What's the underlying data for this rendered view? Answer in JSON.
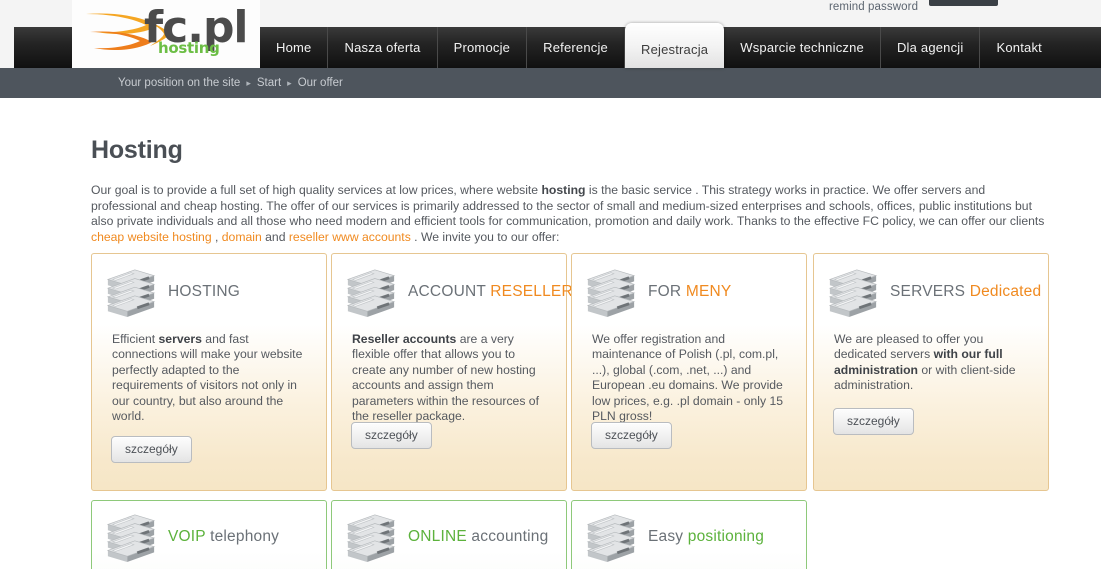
{
  "top": {
    "remind_password": "remind password"
  },
  "logo": {
    "word": "fc.pl",
    "sub": "hosting",
    "swoosh_icon": "swoosh-icon"
  },
  "nav": {
    "items": [
      {
        "label": "Home",
        "active": false
      },
      {
        "label": "Nasza oferta",
        "active": false
      },
      {
        "label": "Promocje",
        "active": false
      },
      {
        "label": "Referencje",
        "active": false
      },
      {
        "label": "Rejestracja",
        "active": true
      },
      {
        "label": "Wsparcie techniczne",
        "active": false
      },
      {
        "label": "Dla agencji",
        "active": false
      },
      {
        "label": "Kontakt",
        "active": false
      }
    ]
  },
  "breadcrumb": {
    "label": "Your position on the site",
    "sep": "▸",
    "items": [
      "Start",
      "Our offer"
    ]
  },
  "main": {
    "title": "Hosting",
    "intro_prefix": "Our goal is to provide a full set of high quality services at low prices, where website ",
    "intro_b1": "hosting",
    "intro_mid": " is the basic service . This strategy works in practice. We offer servers and professional and cheap hosting. The offer of our services is primarily addressed to the sector of small and medium-sized enterprises and schools, offices, public institutions but also private individuals and all those who need modern and efficient tools for communication, promotion and daily work. Thanks to the effective FC policy, we can offer our clients ",
    "link1": "cheap website hosting",
    "comma": " , ",
    "link2": "domain",
    "and": " and ",
    "link3": "reseller www accounts",
    "intro_suffix": " . We invite you to our offer:"
  },
  "cards": [
    {
      "icon": "server-stack-icon",
      "title_part1": "HOSTING",
      "title_part1_color": "gray",
      "title_part2": "",
      "title_part2_color": "gray",
      "body_pre": "Efficient ",
      "body_b": "servers",
      "body_post": " and fast connections will make your website perfectly adapted to the requirements of visitors not only in our country, but also around the world.",
      "button": "szczegóły"
    },
    {
      "icon": "server-stack-icon",
      "title_part1": "ACCOUNT ",
      "title_part1_color": "gray",
      "title_part2": "RESELLER",
      "title_part2_color": "orange",
      "body_pre": "",
      "body_b": "Reseller accounts",
      "body_post": " are a very flexible offer that allows you to create any number of new hosting accounts and assign them parameters within the resources of the reseller package.",
      "button": "szczegóły"
    },
    {
      "icon": "server-stack-icon",
      "title_part1": "FOR ",
      "title_part1_color": "gray",
      "title_part2": "MENY",
      "title_part2_color": "orange",
      "body_pre": "We offer registration and maintenance of Polish (.pl, com.pl, ...), global (.com, .net, ...) and European .eu domains. We provide low prices, e.g. .pl domain - only 15 PLN gross!",
      "body_b": "",
      "body_post": "",
      "button": "szczegóły"
    },
    {
      "icon": "server-stack-icon",
      "title_part1": "SERVERS ",
      "title_part1_color": "gray",
      "title_part2": "Dedicated",
      "title_part2_color": "orange",
      "body_pre": "We are pleased to offer you dedicated servers ",
      "body_b": "with our full administration",
      "body_post": " or with client-side administration.",
      "button": "szczegóły"
    }
  ],
  "cards_small": [
    {
      "icon": "server-stack-icon",
      "title_part1": "VOIP ",
      "title_part1_color": "green",
      "title_part2": "telephony",
      "title_part2_color": "gray"
    },
    {
      "icon": "server-stack-icon",
      "title_part1": "ONLINE ",
      "title_part1_color": "green",
      "title_part2": "accounting",
      "title_part2_color": "gray"
    },
    {
      "icon": "server-stack-icon",
      "title_part1": "Easy ",
      "title_part1_color": "gray",
      "title_part2": "positioning",
      "title_part2_color": "green"
    }
  ],
  "colors": {
    "accent_orange": "#f08a20",
    "accent_green": "#5cb23c",
    "nav_dark": "#141414",
    "breadcrumb_bar": "#4e555d",
    "card_border": "#e6c691",
    "card_border_green": "#8ec97a"
  }
}
